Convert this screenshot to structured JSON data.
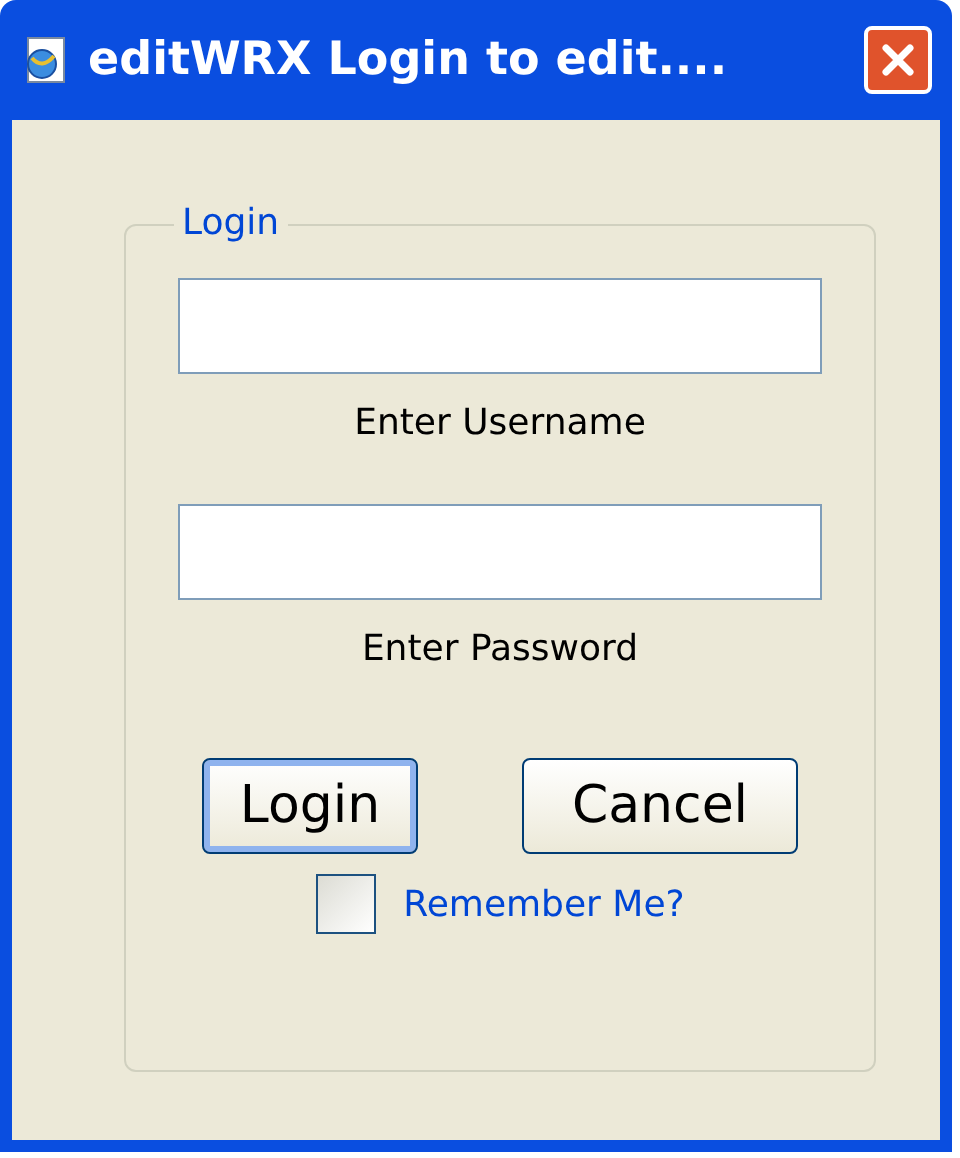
{
  "window": {
    "title": "editWRX Login to edit...."
  },
  "group": {
    "legend": "Login"
  },
  "fields": [
    {
      "label": "Enter Username"
    },
    {
      "label": "Enter Password"
    }
  ],
  "buttons": [
    {
      "label": "Login",
      "default": true
    },
    {
      "label": "Cancel",
      "default": false
    }
  ],
  "remember": {
    "label": "Remember Me?",
    "checked": false
  }
}
